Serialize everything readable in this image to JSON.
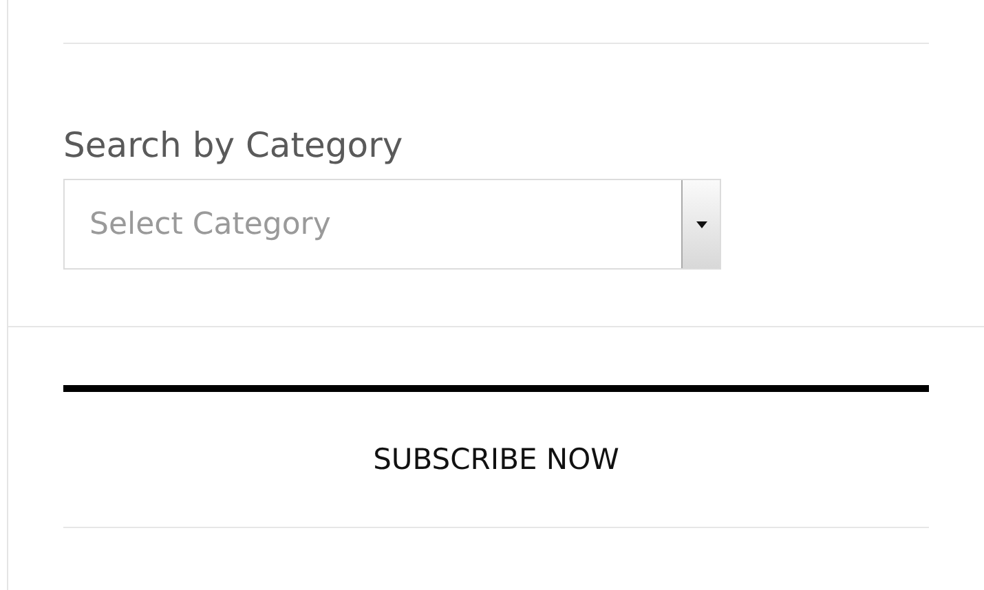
{
  "category_search": {
    "heading": "Search by Category",
    "select": {
      "placeholder": "Select Category"
    }
  },
  "subscribe": {
    "label": "SUBSCRIBE NOW"
  }
}
